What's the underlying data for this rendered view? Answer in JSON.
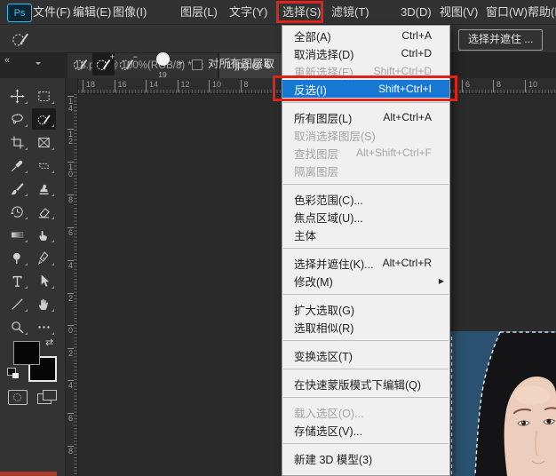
{
  "window": {
    "logo_text": "Ps"
  },
  "menu_bar": {
    "items": [
      {
        "label": "文件(F)"
      },
      {
        "label": "编辑(E)"
      },
      {
        "label": "图像(I)"
      },
      {
        "label": "图层(L)"
      },
      {
        "label": "文字(Y)"
      },
      {
        "label": "选择(S)",
        "boxed": true
      },
      {
        "label": "滤镜(T)"
      },
      {
        "label": "3D(D)"
      },
      {
        "label": "视图(V)"
      },
      {
        "label": "窗口(W)"
      },
      {
        "label": "帮助(H)"
      }
    ]
  },
  "options_bar": {
    "brush_size": "19",
    "sample_all_layers_label": "对所有图层取",
    "select_and_mask_button": "选择并遮住 ..."
  },
  "tabs": [
    {
      "title": "18.psd @ 100%(RGB/8) *"
    },
    {
      "title": "1.jpg @ 6"
    }
  ],
  "dropdown_menu": {
    "items": [
      {
        "label": "全部(A)",
        "shortcut": "Ctrl+A"
      },
      {
        "label": "取消选择(D)",
        "shortcut": "Ctrl+D"
      },
      {
        "label": "重新选择(E)",
        "shortcut": "Shift+Ctrl+D",
        "state": "disabled"
      },
      {
        "label": "反选(I)",
        "shortcut": "Shift+Ctrl+I",
        "state": "highlighted",
        "annotated": true
      },
      {
        "type": "separator"
      },
      {
        "label": "所有图层(L)",
        "shortcut": "Alt+Ctrl+A"
      },
      {
        "label": "取消选择图层(S)",
        "state": "disabled"
      },
      {
        "label": "查找图层",
        "shortcut": "Alt+Shift+Ctrl+F",
        "state": "disabled"
      },
      {
        "label": "隔离图层",
        "state": "disabled"
      },
      {
        "type": "separator"
      },
      {
        "label": "色彩范围(C)..."
      },
      {
        "label": "焦点区域(U)..."
      },
      {
        "label": "主体"
      },
      {
        "type": "separator"
      },
      {
        "label": "选择并遮住(K)...",
        "shortcut": "Alt+Ctrl+R"
      },
      {
        "label": "修改(M)",
        "submenu": true
      },
      {
        "type": "separator"
      },
      {
        "label": "扩大选取(G)"
      },
      {
        "label": "选取相似(R)"
      },
      {
        "type": "separator"
      },
      {
        "label": "变换选区(T)"
      },
      {
        "type": "separator"
      },
      {
        "label": "在快速蒙版模式下编辑(Q)"
      },
      {
        "type": "separator"
      },
      {
        "label": "载入选区(O)...",
        "state": "disabled"
      },
      {
        "label": "存储选区(V)..."
      },
      {
        "type": "separator"
      },
      {
        "label": "新建 3D 模型(3)"
      }
    ]
  },
  "rulers": {
    "horizontal_left": [
      "18",
      "16",
      "14",
      "12",
      "10",
      "8"
    ],
    "horizontal_right": [
      "6",
      "8",
      "10"
    ],
    "vertical": [
      "14",
      "12",
      "10",
      "8",
      "6",
      "4",
      "2",
      "0",
      "2",
      "4",
      "6",
      "8"
    ]
  },
  "tools": [
    {
      "name": "move-tool",
      "icon": "move"
    },
    {
      "name": "marquee-tool",
      "icon": "marquee"
    },
    {
      "name": "lasso-tool",
      "icon": "lasso"
    },
    {
      "name": "selection-brush-tool",
      "icon": "selbrush",
      "selected": true
    },
    {
      "name": "crop-tool",
      "icon": "crop"
    },
    {
      "name": "frame-tool",
      "icon": "frame"
    },
    {
      "name": "eyedropper-tool",
      "icon": "eyedropper"
    },
    {
      "name": "patch-tool",
      "icon": "patch"
    },
    {
      "name": "brush-tool",
      "icon": "brush"
    },
    {
      "name": "clone-stamp-tool",
      "icon": "stamp"
    },
    {
      "name": "history-brush-tool",
      "icon": "history"
    },
    {
      "name": "eraser-tool",
      "icon": "eraser"
    },
    {
      "name": "gradient-tool",
      "icon": "gradient"
    },
    {
      "name": "smudge-tool",
      "icon": "smudge"
    },
    {
      "name": "dodge-tool",
      "icon": "dodge"
    },
    {
      "name": "pen-tool",
      "icon": "pen"
    },
    {
      "name": "type-tool",
      "icon": "type"
    },
    {
      "name": "path-select-tool",
      "icon": "arrow"
    },
    {
      "name": "line-tool",
      "icon": "line"
    },
    {
      "name": "hand-tool",
      "icon": "hand"
    },
    {
      "name": "zoom-tool",
      "icon": "zoom"
    },
    {
      "name": "edit-toolbar-button",
      "icon": "dots"
    }
  ],
  "icons": {
    "collapse": "«",
    "close": "×",
    "submenu_arrow": "▶",
    "dropdown_chevron": "▾",
    "plus": "+",
    "minus": "−",
    "swap_colors": "⇄"
  },
  "colors": {
    "annotation_red": "#e2211c",
    "menu_highlight_blue": "#1678d4",
    "photo_background_blue": "#2a5170"
  }
}
